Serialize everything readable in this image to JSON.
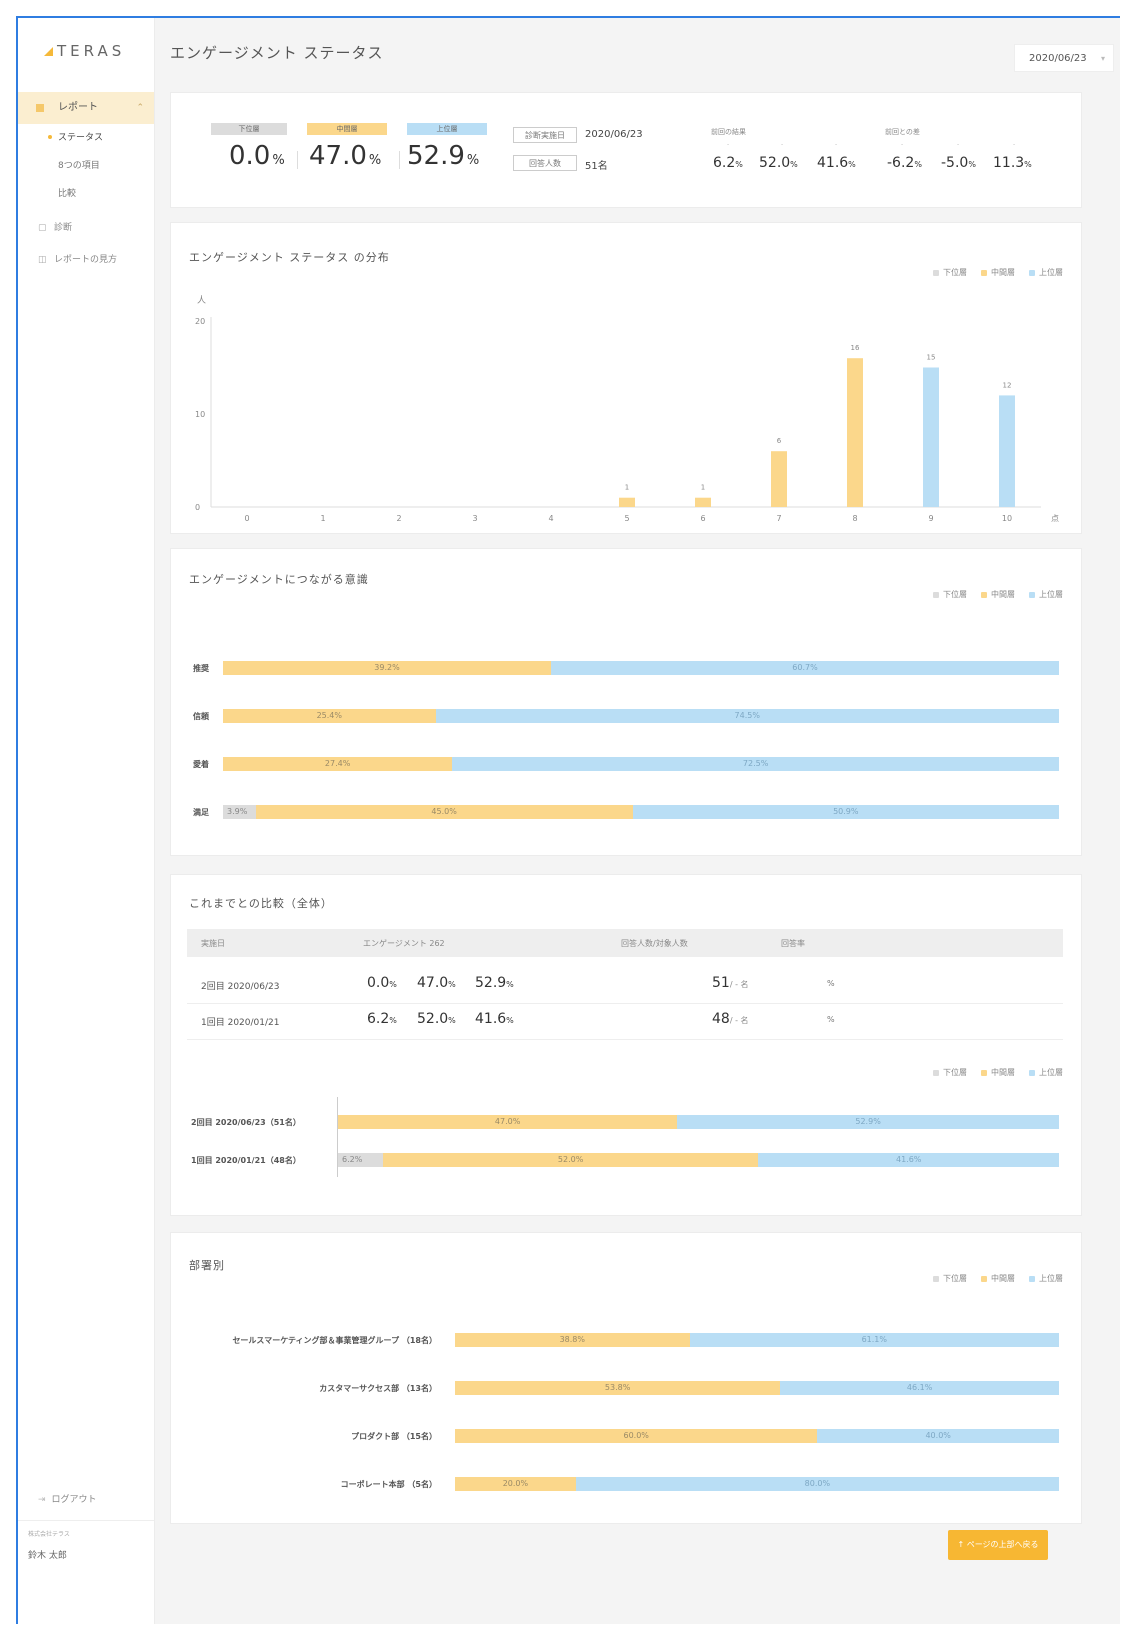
{
  "brand": {
    "name": "TERAS"
  },
  "sidebar": {
    "report_label": "レポート",
    "sub_items": [
      "ステータス",
      "8つの項目",
      "比較"
    ],
    "links": [
      {
        "label": "診断",
        "icon": "calendar-icon"
      },
      {
        "label": "レポートの見方",
        "icon": "book-icon"
      }
    ],
    "logout_label": "ログアウト",
    "company": "株式会社テラス",
    "user_name": "鈴木 太郎"
  },
  "header": {
    "title": "エンゲージメント ステータス",
    "date": "2020/06/23"
  },
  "colors": {
    "low": "#dcdcdc",
    "mid": "#fbd78b",
    "high": "#b9def5",
    "accent": "#f7b733"
  },
  "legend": {
    "low": "下位層",
    "mid": "中間層",
    "high": "上位層"
  },
  "summary": {
    "low_label": "下位層",
    "mid_label": "中間層",
    "high_label": "上位層",
    "low": "0.0",
    "mid": "47.0",
    "high": "52.9",
    "unit": "%",
    "date_label": "診断実施日",
    "date_value": "2020/06/23",
    "count_label": "回答人数",
    "count_value": "51名",
    "prev_label": "前回の結果",
    "prev": [
      "6.2",
      "52.0",
      "41.6"
    ],
    "diff_label": "前回との差",
    "diff": [
      "-6.2",
      "-5.0",
      "11.3"
    ],
    "tick_labels": [
      "-",
      "-",
      "-"
    ]
  },
  "distribution": {
    "title": "エンゲージメント ステータス の分布",
    "y_unit": "人",
    "x_unit": "点"
  },
  "awareness": {
    "title": "エンゲージメントにつながる意識",
    "rows": [
      {
        "label": "推奨",
        "low": "",
        "mid": "39.2%",
        "high": "60.7%",
        "low_v": 0,
        "mid_v": 39.2,
        "high_v": 60.7
      },
      {
        "label": "信頼",
        "low": "",
        "mid": "25.4%",
        "high": "74.5%",
        "low_v": 0,
        "mid_v": 25.4,
        "high_v": 74.5
      },
      {
        "label": "愛着",
        "low": "",
        "mid": "27.4%",
        "high": "72.5%",
        "low_v": 0,
        "mid_v": 27.4,
        "high_v": 72.5
      },
      {
        "label": "満足",
        "low": "3.9%",
        "mid": "45.0%",
        "high": "50.9%",
        "low_v": 3.9,
        "mid_v": 45.0,
        "high_v": 50.9
      }
    ]
  },
  "history": {
    "title": "これまでとの比較（全体）",
    "headers": {
      "date": "実施日",
      "engagement": "エンゲージメント 262",
      "count": "回答人数/対象人数",
      "rate": "回答率"
    },
    "rows": [
      {
        "date": "2回目 2020/06/23",
        "low": "0.0",
        "mid": "47.0",
        "high": "52.9",
        "count": "51",
        "count_sub": "/ - 名",
        "rate": "%"
      },
      {
        "date": "1回目 2020/01/21",
        "low": "6.2",
        "mid": "52.0",
        "high": "41.6",
        "count": "48",
        "count_sub": "/ - 名",
        "rate": "%"
      }
    ],
    "bars": [
      {
        "label": "2回目  2020/06/23（51名）",
        "low": "",
        "mid": "47.0%",
        "high": "52.9%",
        "low_v": 0,
        "mid_v": 47.0,
        "high_v": 52.9
      },
      {
        "label": "1回目  2020/01/21（48名）",
        "low": "6.2%",
        "mid": "52.0%",
        "high": "41.6%",
        "low_v": 6.2,
        "mid_v": 52.0,
        "high_v": 41.6
      }
    ]
  },
  "departments": {
    "title": "部署別",
    "rows": [
      {
        "label": "セールスマーケティング部＆事業管理グループ （18名）",
        "low": "",
        "mid": "38.8%",
        "high": "61.1%",
        "low_v": 0,
        "mid_v": 38.8,
        "high_v": 61.1
      },
      {
        "label": "カスタマーサクセス部 （13名）",
        "low": "",
        "mid": "53.8%",
        "high": "46.1%",
        "low_v": 0,
        "mid_v": 53.8,
        "high_v": 46.1
      },
      {
        "label": "プロダクト部 （15名）",
        "low": "",
        "mid": "60.0%",
        "high": "40.0%",
        "low_v": 0,
        "mid_v": 60.0,
        "high_v": 40.0
      },
      {
        "label": "コーポレート本部 （5名）",
        "low": "",
        "mid": "20.0%",
        "high": "80.0%",
        "low_v": 0,
        "mid_v": 20.0,
        "high_v": 80.0
      }
    ]
  },
  "footer": {
    "back_to_top": "↑ ページの上部へ戻る"
  },
  "chart_data": {
    "type": "bar",
    "title": "エンゲージメント ステータス の分布",
    "xlabel": "点",
    "ylabel": "人",
    "categories": [
      "0",
      "1",
      "2",
      "3",
      "4",
      "5",
      "6",
      "7",
      "8",
      "9",
      "10"
    ],
    "values": [
      0,
      0,
      0,
      0,
      0,
      1,
      1,
      6,
      16,
      15,
      12
    ],
    "data_labels": [
      "",
      "",
      "",
      "",
      "",
      "1",
      "1",
      "6",
      "16",
      "15",
      "12"
    ],
    "bar_groups": [
      "low",
      "low",
      "low",
      "low",
      "low",
      "mid",
      "mid",
      "mid",
      "mid",
      "high",
      "high"
    ],
    "ylim": [
      0,
      20
    ],
    "yticks": [
      0,
      10,
      20
    ],
    "legend": [
      "下位層",
      "中間層",
      "上位層"
    ],
    "legend_position": "top-right",
    "grid": false
  }
}
